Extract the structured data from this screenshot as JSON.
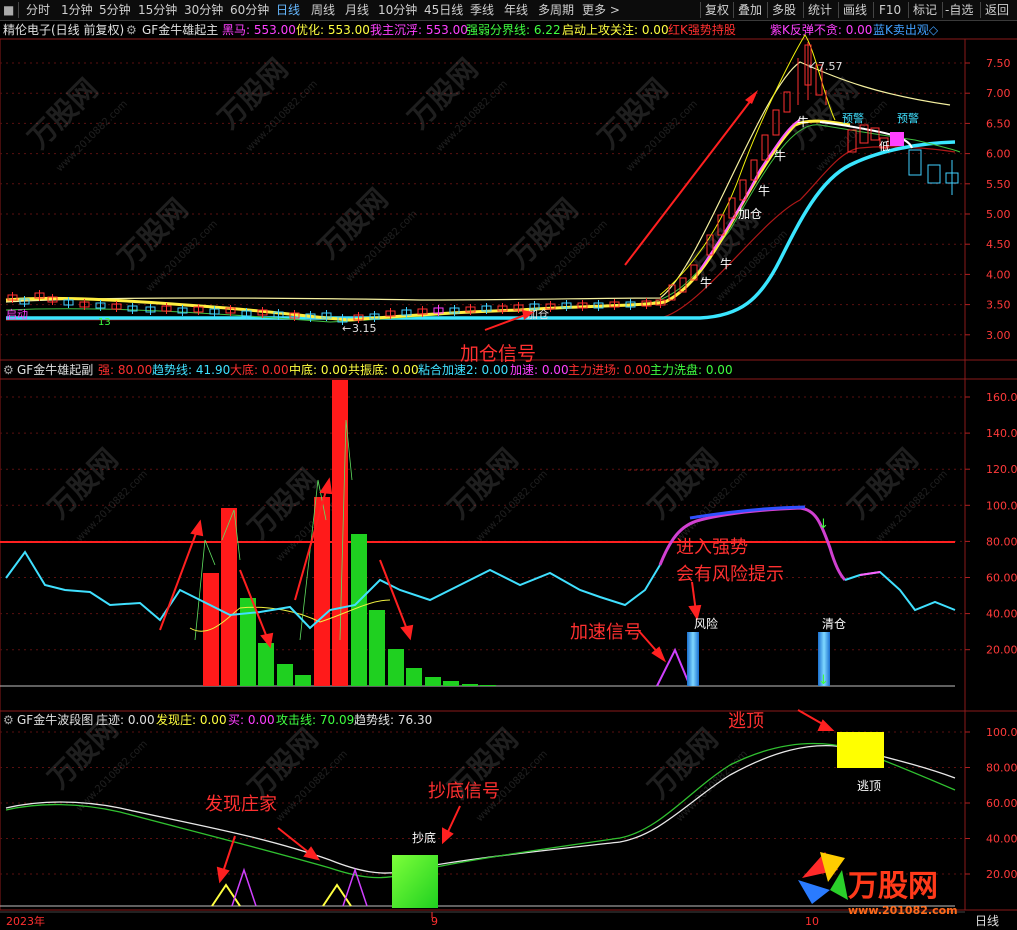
{
  "toolbar": {
    "left": [
      "分时",
      "1分钟",
      "5分钟",
      "15分钟",
      "30分钟",
      "60分钟",
      "日线",
      "周线",
      "月线",
      "10分钟",
      "45日线",
      "季线",
      "年线",
      "多周期",
      "更多 >"
    ],
    "active_index": 6,
    "right": [
      "复权",
      "叠加",
      "多股",
      "统计",
      "画线",
      "F10",
      "标记",
      "-自选",
      "返回"
    ]
  },
  "panel1": {
    "stock": "精伦电子(日线 前复权)",
    "indicator": "GF金牛雄起主",
    "fields": [
      {
        "label": "黑马: 553.00",
        "color": "#ff40ff"
      },
      {
        "label": "优化: 553.00",
        "color": "#ffff40"
      },
      {
        "label": "我主沉浮: 553.00",
        "color": "#ff40ff"
      },
      {
        "label": "强弱分界线: 6.22",
        "color": "#40ff40"
      },
      {
        "label": "启动上攻关注: 0.00",
        "color": "#ffff40"
      },
      {
        "label": "红K强势持股",
        "color": "#ff3030"
      },
      {
        "label": "紫K反弹不贪: 0.00",
        "color": "#ff40ff"
      },
      {
        "label": "蓝K卖出观◇",
        "color": "#40a0ff"
      }
    ],
    "yticks": [
      "7.50",
      "7.00",
      "6.50",
      "6.00",
      "5.50",
      "5.00",
      "4.50",
      "4.00",
      "3.50",
      "3.00"
    ],
    "ann": {
      "high": "7.57",
      "low": "3.15",
      "qidong": "启动",
      "thirteen": "13",
      "jiacang_small": "加仓",
      "jiacang_mid": "加仓",
      "niu": "牛",
      "yujing": "预警",
      "di": "低"
    },
    "signal": "加仓信号"
  },
  "panel2": {
    "indicator": "GF金牛雄起副",
    "fields": [
      {
        "label": "强: 80.00",
        "color": "#ff3030"
      },
      {
        "label": "趋势线: 41.90",
        "color": "#40e0ff"
      },
      {
        "label": "大底: 0.00",
        "color": "#ff3030"
      },
      {
        "label": "中底: 0.00",
        "color": "#ffff40"
      },
      {
        "label": "共振底: 0.00",
        "color": "#ffff40"
      },
      {
        "label": "粘合加速2: 0.00",
        "color": "#40e0ff"
      },
      {
        "label": "加速: 0.00",
        "color": "#ff40ff"
      },
      {
        "label": "主力进场: 0.00",
        "color": "#ff3030"
      },
      {
        "label": "主力洗盘: 0.00",
        "color": "#40ff40"
      }
    ],
    "yticks": [
      "160.0",
      "140.0",
      "120.0",
      "100.0",
      "80.00",
      "60.00",
      "40.00",
      "20.00"
    ],
    "ann": {
      "qiangshi1": "进入强势",
      "qiangshi2": "会有风险提示",
      "jiasu": "加速信号",
      "fengxian": "风险",
      "qingcang": "清仓"
    }
  },
  "panel3": {
    "indicator": "GF金牛波段图",
    "fields": [
      {
        "label": "庄迹: 0.00",
        "color": "#e0e0e0"
      },
      {
        "label": "发现庄: 0.00",
        "color": "#ffff40"
      },
      {
        "label": "买: 0.00",
        "color": "#ff40ff"
      },
      {
        "label": "攻击线: 70.09",
        "color": "#40ff40"
      },
      {
        "label": "趋势线: 76.30",
        "color": "#e0e0e0"
      }
    ],
    "yticks": [
      "100.0",
      "80.00",
      "60.00",
      "40.00",
      "20.00"
    ],
    "ann": {
      "taoding": "逃顶",
      "taoding_box": "逃顶",
      "chaodi": "抄底",
      "faxian": "发现庄家",
      "chaodi_sig": "抄底信号"
    }
  },
  "footer": {
    "year": "2023年",
    "mark9": "9",
    "mark_right": "10",
    "period": "日线"
  },
  "watermark": {
    "brand": "万股网",
    "url": "www.2010882.com"
  },
  "logo": {
    "brand": "万股网",
    "url": "www.201082.com"
  }
}
